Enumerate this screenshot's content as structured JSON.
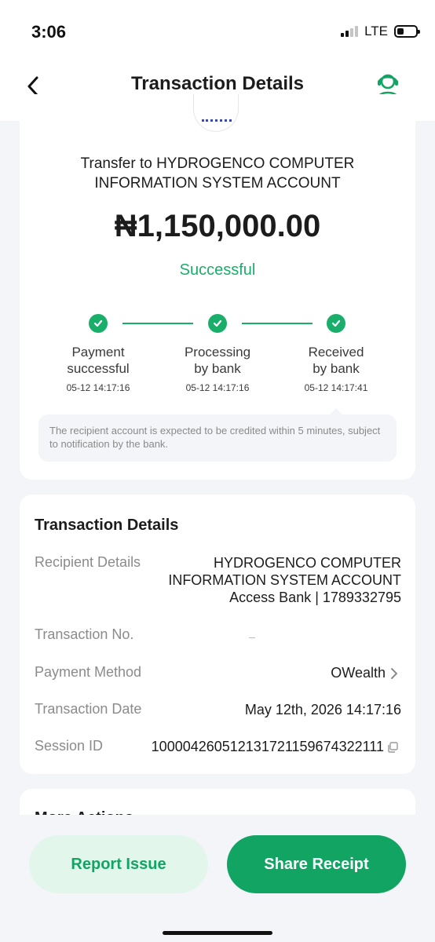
{
  "status_bar": {
    "time": "3:06",
    "network": "LTE"
  },
  "header": {
    "title": "Transaction Details",
    "back_icon": "chevron-left-icon",
    "support_icon": "customer-support-icon"
  },
  "summary": {
    "transfer_title": "Transfer to HYDROGENCO COMPUTER INFORMATION SYSTEM ACCOUNT",
    "amount": "₦1,150,000.00",
    "status": "Successful",
    "steps": [
      {
        "label": "Payment successful",
        "time": "05-12 14:17:16"
      },
      {
        "label": "Processing by bank",
        "time": "05-12 14:17:16"
      },
      {
        "label": "Received by bank",
        "time": "05-12 14:17:41"
      }
    ],
    "notice": "The recipient account is expected to be credited within 5 minutes, subject to notification by the bank."
  },
  "details": {
    "heading": "Transaction Details",
    "rows": [
      {
        "label": "Recipient Details",
        "value_lines": [
          "HYDROGENCO COMPUTER",
          "INFORMATION SYSTEM ACCOUNT",
          "Access Bank | 1789332795"
        ]
      },
      {
        "label": "Transaction No.",
        "value": ""
      },
      {
        "label": "Payment Method",
        "value": "OWealth"
      },
      {
        "label": "Transaction Date",
        "value": "May 12th, 2026 14:17:16"
      },
      {
        "label": "Session ID",
        "value": "100004260512131721159674322111"
      }
    ]
  },
  "more_actions": {
    "heading": "More Actions"
  },
  "actions": {
    "report_label": "Report Issue",
    "share_label": "Share Receipt"
  },
  "colors": {
    "accent": "#12a462",
    "accent_light": "#e2f6ec",
    "background": "#f4f5f9"
  }
}
